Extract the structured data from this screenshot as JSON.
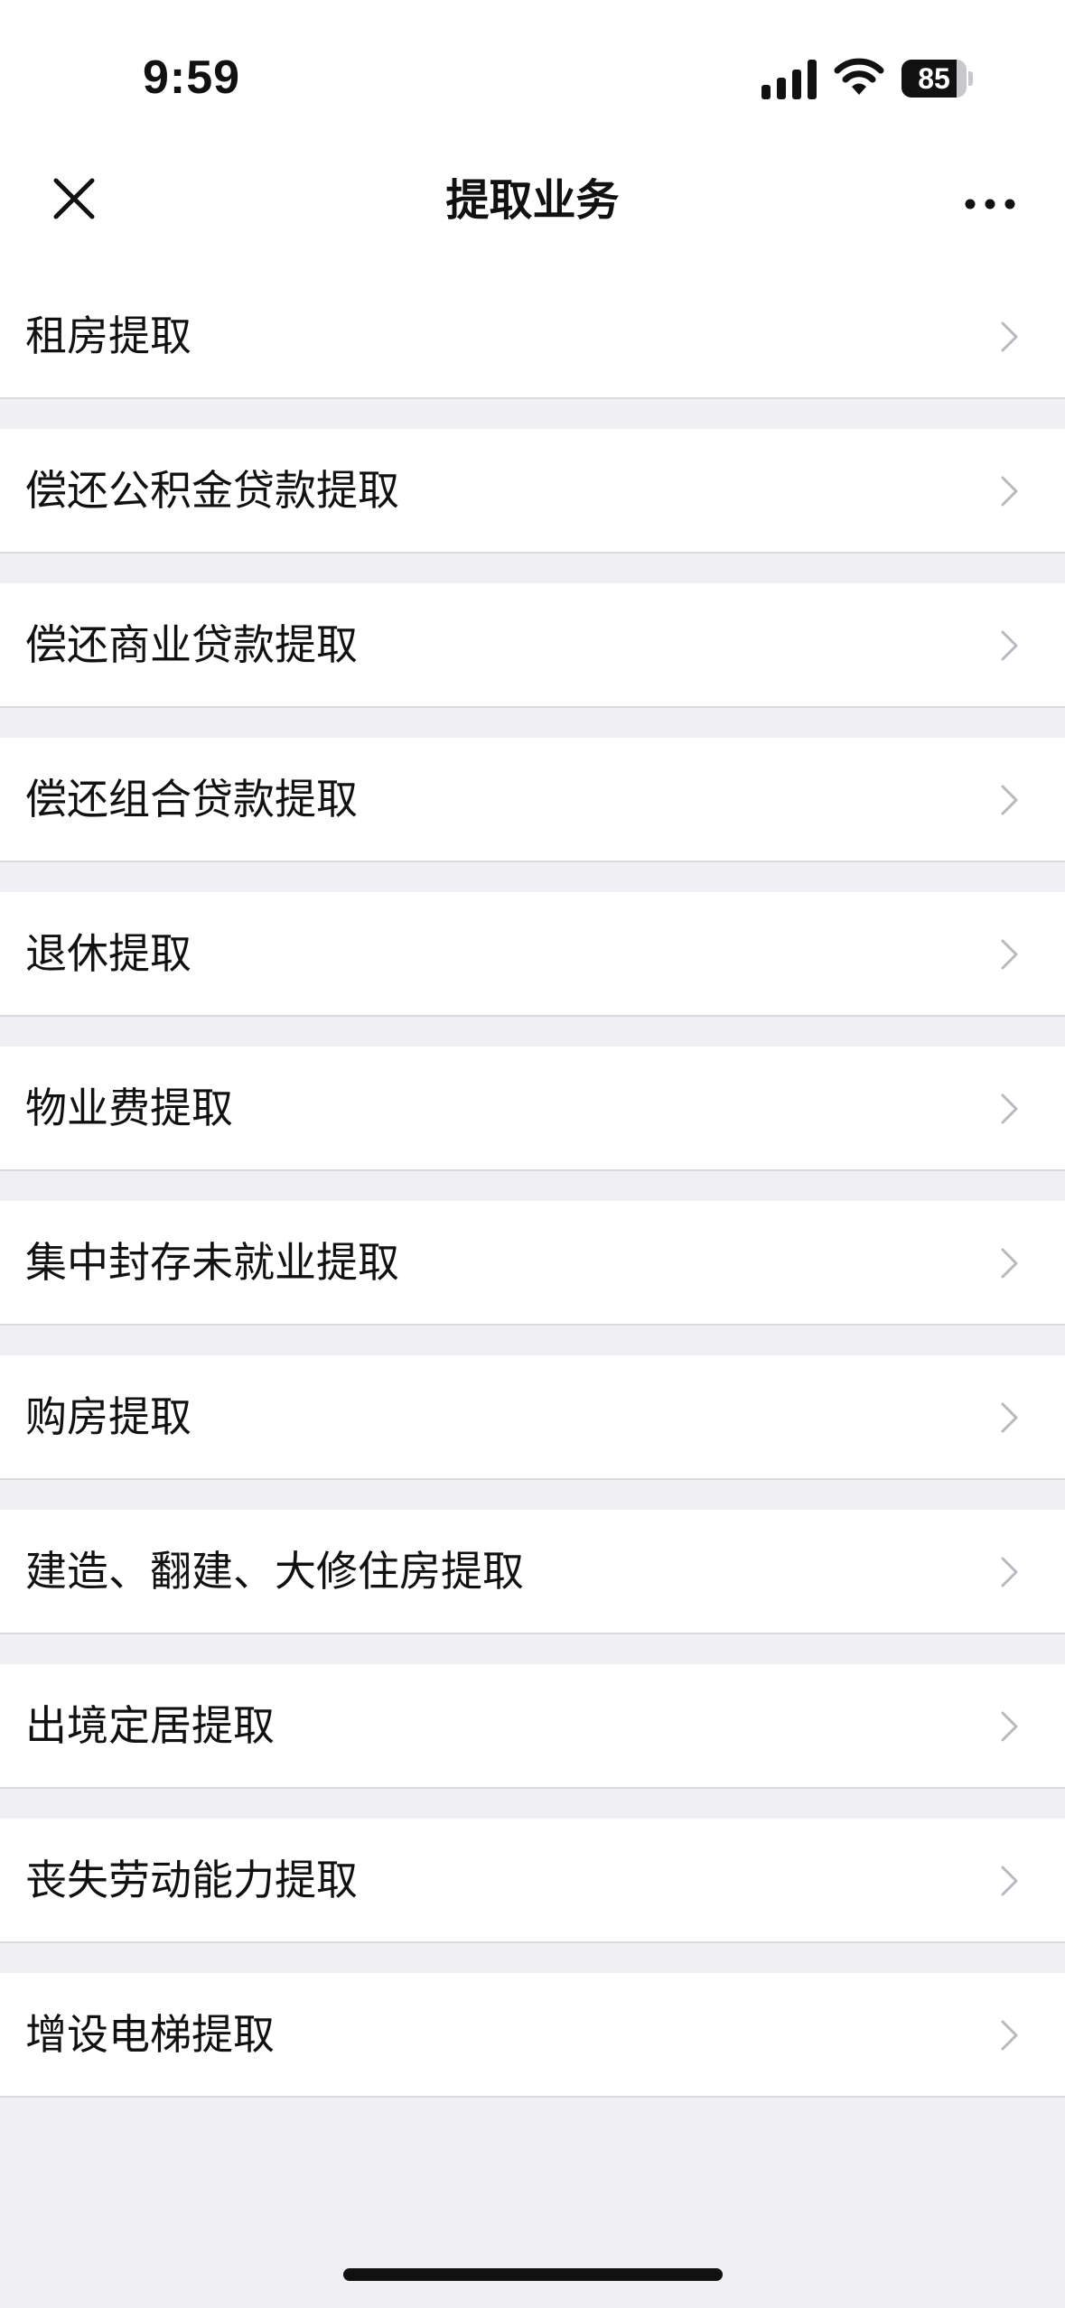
{
  "status_bar": {
    "time": "9:59",
    "battery_percent": "85",
    "battery_level": 0.85,
    "icons": [
      "signal-icon",
      "wifi-icon",
      "battery-icon"
    ]
  },
  "nav_bar": {
    "title": "提取业务",
    "left_icon": "close-icon",
    "right_icon": "more-icon"
  },
  "menu": {
    "items": [
      {
        "label": "租房提取"
      },
      {
        "label": "偿还公积金贷款提取"
      },
      {
        "label": "偿还商业贷款提取"
      },
      {
        "label": "偿还组合贷款提取"
      },
      {
        "label": "退休提取"
      },
      {
        "label": "物业费提取"
      },
      {
        "label": "集中封存未就业提取"
      },
      {
        "label": "购房提取"
      },
      {
        "label": "建造、翻建、大修住房提取"
      },
      {
        "label": "出境定居提取"
      },
      {
        "label": "丧失劳动能力提取"
      },
      {
        "label": "增设电梯提取"
      }
    ]
  },
  "colors": {
    "background": "#efeff4",
    "row_background": "#ffffff",
    "divider": "#d9d9de",
    "chevron": "#b8b8bd",
    "text": "#111111"
  }
}
